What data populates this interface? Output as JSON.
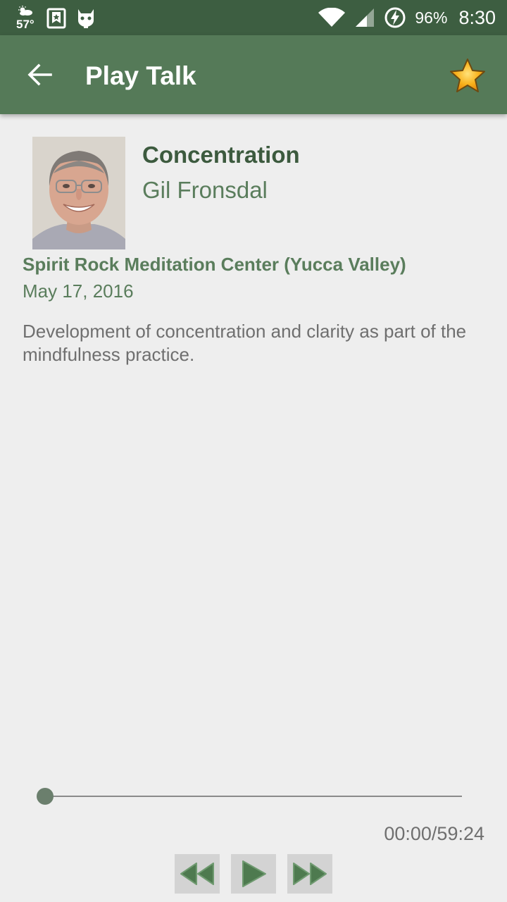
{
  "status_bar": {
    "temperature": "57°",
    "battery_percent": "96%",
    "time": "8:30",
    "icons": [
      "weather-icon",
      "bookmark-app-icon",
      "cyanogen-mascot-icon",
      "wifi-icon",
      "signal-icon",
      "battery-charging-icon"
    ]
  },
  "app_bar": {
    "title": "Play Talk",
    "back_icon": "back-arrow-icon",
    "favorite_icon": "star-icon",
    "color": "#557a58"
  },
  "talk": {
    "title": "Concentration",
    "speaker": "Gil Fronsdal",
    "venue": "Spirit Rock Meditation Center (Yucca Valley)",
    "date": "May 17, 2016",
    "description": "Development of concentration and clarity as part of the mindfulness practice."
  },
  "player": {
    "position_fraction": 0,
    "time_display": "00:00/59:24",
    "buttons": [
      "rewind-icon",
      "play-icon",
      "fast-forward-icon"
    ],
    "accent_color": "#4e7a4f"
  }
}
